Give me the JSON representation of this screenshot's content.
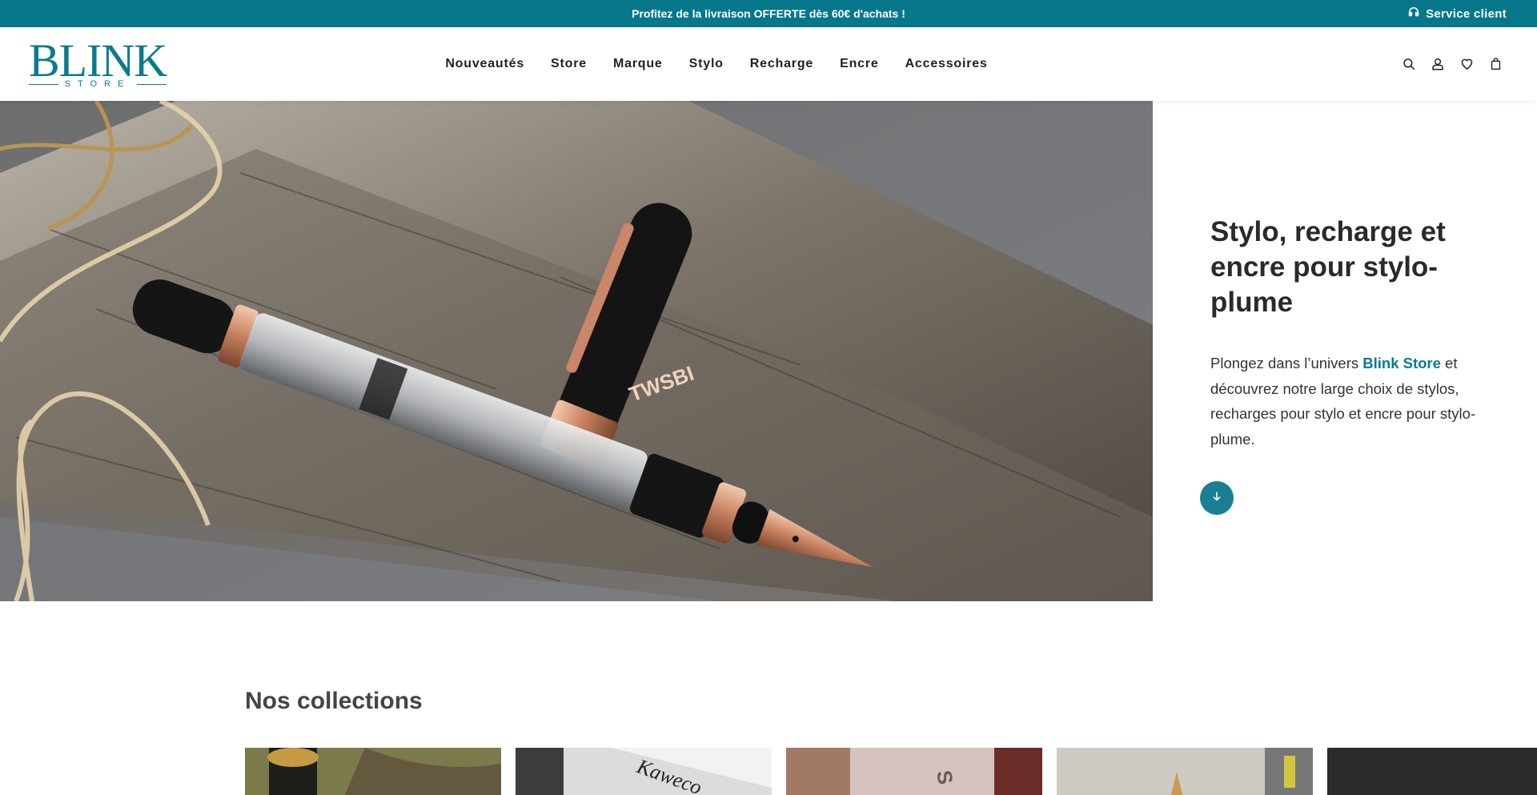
{
  "announcement": {
    "text": "Profitez de la livraison OFFERTE dès 60€ d'achats !",
    "service_label": "Service client",
    "service_icon": "headset-icon",
    "background": "#07778c"
  },
  "header": {
    "logo_word": "BLINK",
    "logo_sub": "STORE",
    "nav": [
      "Nouveautés",
      "Store",
      "Marque",
      "Stylo",
      "Recharge",
      "Encre",
      "Accessoires"
    ],
    "icons": [
      "search-icon",
      "user-icon",
      "heart-icon",
      "bag-icon"
    ]
  },
  "hero": {
    "title": "Stylo, recharge et encre pour stylo-plume",
    "desc_before": "Plongez dans l’univers ",
    "desc_brand": "Blink Store",
    "desc_after": " et découvrez notre large choix de stylos, recharges pour stylo et encre pour stylo-plume.",
    "scroll_icon": "arrow-down-icon",
    "accent": "#0a7b8f"
  },
  "collections": {
    "title": "Nos collections",
    "cards": [
      "collection-card-1",
      "collection-card-2",
      "collection-card-3",
      "collection-card-4",
      "collection-card-5"
    ]
  }
}
